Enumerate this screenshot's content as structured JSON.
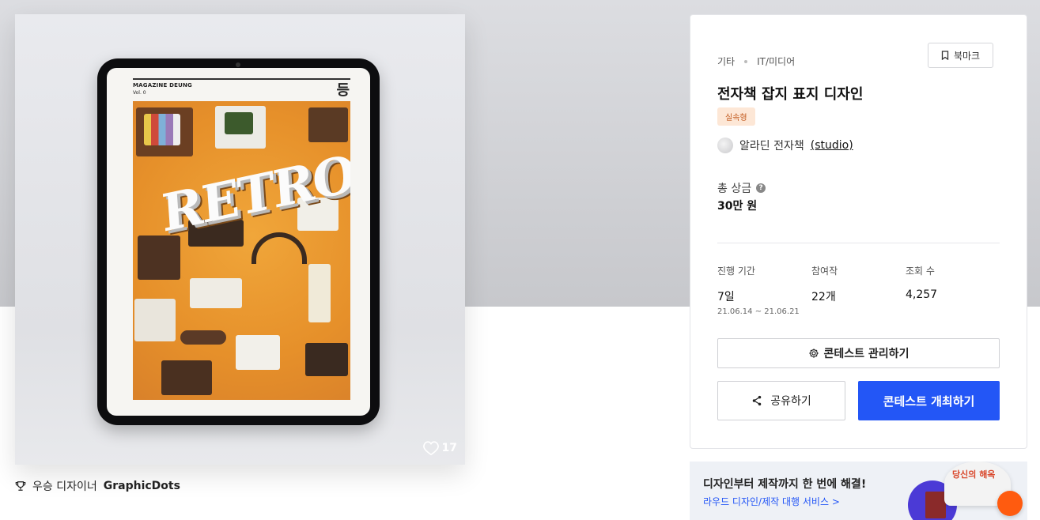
{
  "artwork": {
    "magazine_name": "MAGAZINE DEUNG",
    "magazine_vol": "Vol. 0",
    "magazine_mark": "등",
    "cover_word": "RETRO",
    "like_count": "17",
    "icons": [
      "heart-icon"
    ]
  },
  "winner": {
    "label": "우승 디자이너",
    "name": "GraphicDots",
    "icon": "trophy-icon"
  },
  "contest": {
    "category_1": "기타",
    "category_2": "IT/미디어",
    "bookmark_label": "북마크",
    "title": "전자책 잡지 표지 디자인",
    "type_badge": "실속형",
    "host_name": "알라딘 전자책",
    "host_link": "(studio)",
    "prize_label": "총 상금",
    "prize_value": "30만 원",
    "stats": [
      {
        "label": "진행 기간",
        "value": "7일",
        "sub": "21.06.14 ~ 21.06.21"
      },
      {
        "label": "참여작",
        "value": "22개"
      },
      {
        "label": "조회 수",
        "value": "4,257"
      }
    ],
    "manage_label": "콘테스트 관리하기",
    "share_label": "공유하기",
    "host_button_label": "콘테스트 개최하기",
    "colors": {
      "primary": "#2356f6",
      "badge_bg": "#fde7d6",
      "badge_text": "#c25a1e"
    }
  },
  "banner": {
    "title": "디자인부터 제작까지 한 번에 해결!",
    "link": "라우드 디자인/제작 대행 서비스 >",
    "art_label": "당신의 해옥"
  }
}
